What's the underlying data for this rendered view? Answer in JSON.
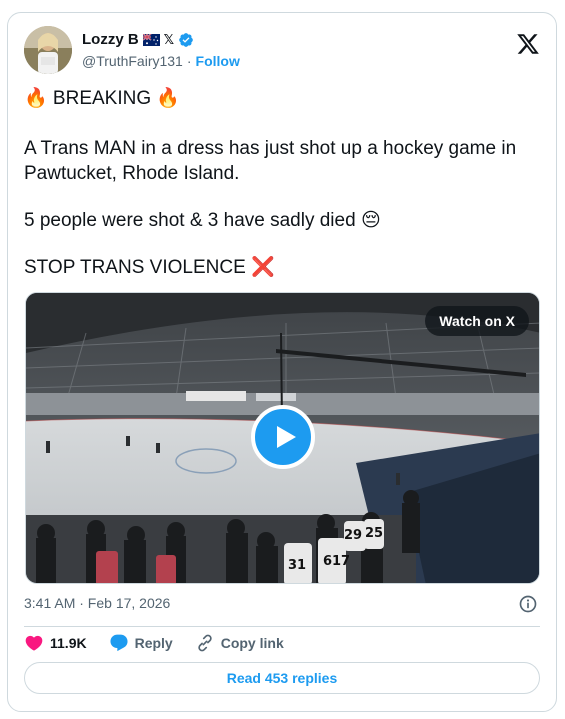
{
  "author": {
    "name": "Lozzy B",
    "flag_icon": "australia-flag-icon",
    "affiliate_badge": "𝕏",
    "verified_icon": "verified-badge-icon",
    "handle": "@TruthFairy131",
    "separator": "·",
    "follow_label": "Follow"
  },
  "tweet": {
    "line1": "🔥 BREAKING 🔥",
    "line2": "A Trans MAN in a dress has just shot up a hockey game in Pawtucket, Rhode Island.",
    "line3": "5 people were shot & 3 have sadly died 😔",
    "line4": "STOP TRANS VIOLENCE ❌"
  },
  "media": {
    "watch_label": "Watch on X",
    "play_icon": "play-icon",
    "jersey_numbers": [
      "31",
      "6",
      "17",
      "29",
      "25"
    ]
  },
  "meta": {
    "timestamp": "3:41 AM · Feb 17, 2026",
    "info_icon": "info-icon"
  },
  "actions": {
    "likes_count": "11.9K",
    "reply_label": "Reply",
    "copy_link_label": "Copy link"
  },
  "footer": {
    "read_replies_label": "Read 453 replies"
  },
  "colors": {
    "accent": "#1d9bf0",
    "like": "#f91880",
    "text": "#0f1419",
    "muted": "#536471",
    "border": "#cfd9de"
  }
}
